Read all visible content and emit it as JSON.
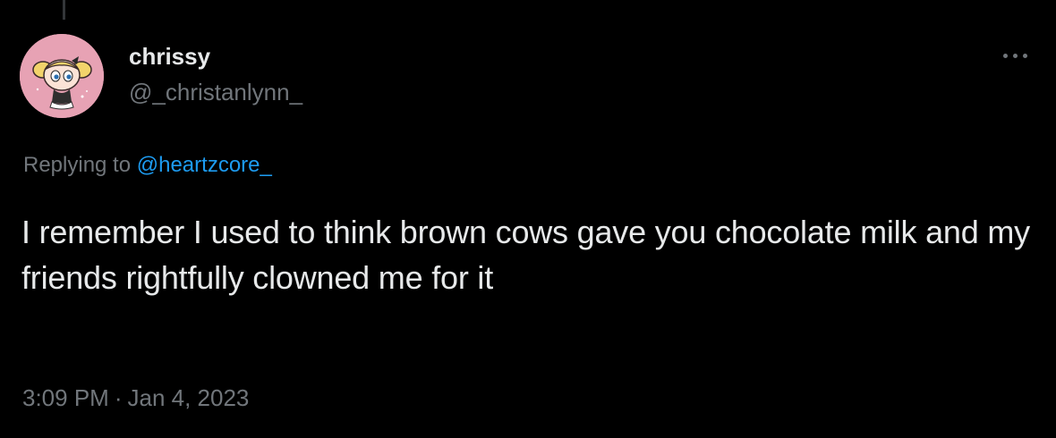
{
  "tweet": {
    "author": {
      "display_name": "chrissy",
      "handle": "@_christanlynn_",
      "avatar_icon": "powerpuff-avatar"
    },
    "replying": {
      "prefix": "Replying to",
      "mention": "@heartzcore_"
    },
    "text": "I remember I used to think brown cows gave you chocolate milk and my friends rightfully clowned me for it",
    "time": "3:09 PM",
    "separator": "·",
    "date": "Jan 4, 2023",
    "more_icon": "more-horizontal-icon"
  },
  "colors": {
    "background": "#000000",
    "primary_text": "#e7e9ea",
    "secondary_text": "#71767b",
    "link": "#1d9bf0",
    "avatar_bg": "#e7a2b4"
  }
}
